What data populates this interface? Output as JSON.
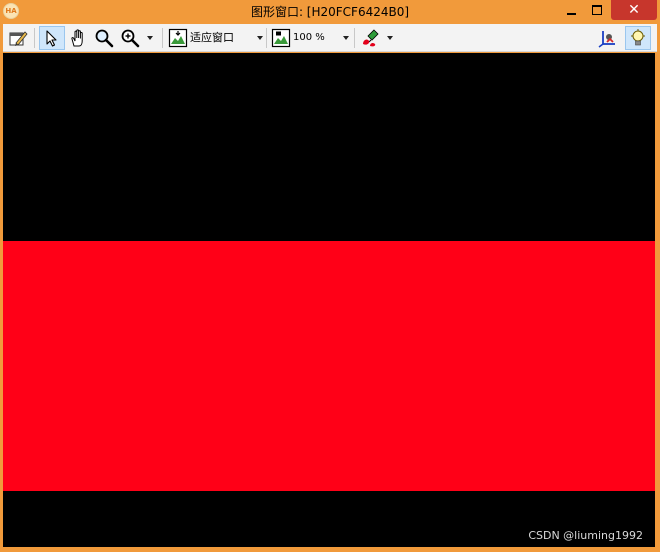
{
  "window": {
    "title": "图形窗口: [H20FCF6424B0]",
    "app_icon_text": "HA",
    "frame_color": "#f19a3b",
    "close_color": "#c7362c",
    "controls": {
      "minimize_icon": "minimize-icon",
      "maximize_icon": "maximize-icon",
      "close_icon": "close-icon",
      "close_glyph": "✕"
    }
  },
  "toolbar": {
    "edit_icon": "edit-window-icon",
    "pointer_icon": "pointer-icon",
    "hand_icon": "hand-pan-icon",
    "magnifier_icon": "magnifier-icon",
    "zoom_icon": "zoom-in-icon",
    "fit_label": "适应窗口",
    "zoom_value": "100 %",
    "color_icon": "color-paint-icon",
    "axes_icon": "axes-icon",
    "light_icon": "lightbulb-icon"
  },
  "canvas": {
    "background": "#000000",
    "band_color": "#ff0017",
    "watermark": "CSDN @liuming1992"
  }
}
